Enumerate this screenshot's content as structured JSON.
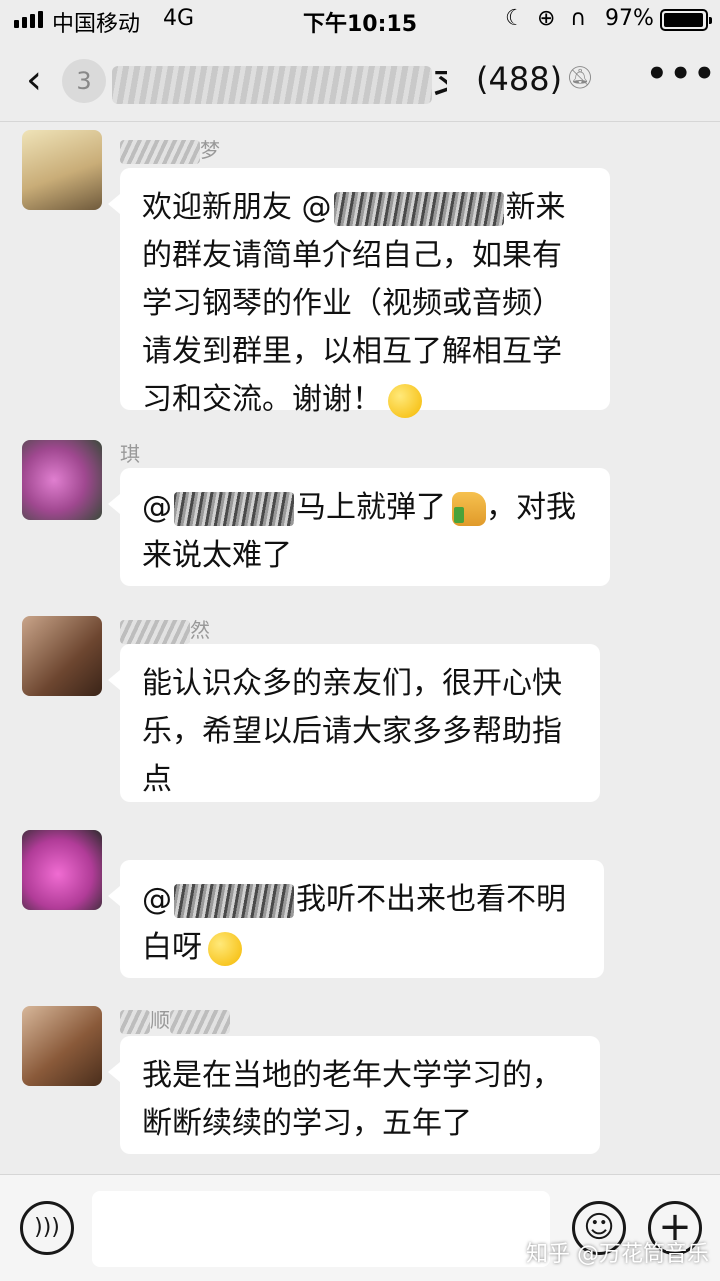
{
  "status_bar": {
    "carrier": "中国移动",
    "network": "4G",
    "time": "下午10:15",
    "battery_percent": "97%",
    "battery_level": 0.97
  },
  "nav": {
    "back_icon": "chevron-left-icon",
    "unread_count": "3",
    "title_visible": "习交...",
    "member_count": "(488)",
    "mute_icon": "bell-muted-icon",
    "more_icon": "more-dots-icon"
  },
  "messages": [
    {
      "sender_partial": "梦",
      "text_before_mention": "欢迎新朋友 @",
      "text_after_mention": "新来的群友请简单介绍自己，如果有学习钢琴的作业（视频或音频）请发到群里，以相互了解相互学习和交流。谢谢！",
      "emoji": "smile-emoji-icon",
      "avatar_color": "#d9c7a0"
    },
    {
      "sender_partial": "琪",
      "text_before_mention": "@",
      "text_after_mention": "马上就弹了",
      "emoji": "thumbs-up-emoji-icon",
      "text_tail": "，对我来说太难了",
      "avatar_color": "#c86fb5"
    },
    {
      "sender_partial": "然",
      "text": "能认识众多的亲友们，很开心快乐，希望以后请大家多多帮助指点",
      "avatar_color": "#8a5a3c"
    },
    {
      "sender_partial": "",
      "text_before_mention": "@",
      "text_after_mention": "我听不出来也看不明白呀",
      "emoji": "laugh-cry-emoji-icon",
      "avatar_color": "#d14fb0"
    },
    {
      "sender_partial": "顺",
      "text": "我是在当地的老年大学学习的，断断续续的学习，五年了",
      "avatar_color": "#9b6b4a"
    }
  ],
  "input_bar": {
    "voice_icon": "voice-icon",
    "emoji_icon": "emoji-face-icon",
    "plus_icon": "plus-icon"
  },
  "watermark": "知乎 @万花筒音乐"
}
